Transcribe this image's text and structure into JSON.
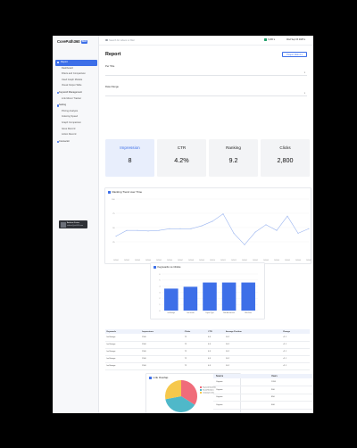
{
  "app": {
    "name": "CorePath360",
    "badge": "SEO"
  },
  "sidebar": {
    "items": [
      {
        "label": "Report",
        "active": true,
        "group": true
      },
      {
        "label": "Dashboard"
      },
      {
        "label": "Filters and Comparison"
      },
      {
        "label": "Used Graph Module"
      },
      {
        "label": "Visual Output Table"
      },
      {
        "label": "Keyword Management",
        "group": true
      },
      {
        "label": "Link Mover Tracker"
      },
      {
        "label": "Setting",
        "group": true
      },
      {
        "label": "Pricing Analysis"
      },
      {
        "label": "Indexing Speed"
      },
      {
        "label": "Graph Comparison"
      },
      {
        "label": "Issue Record"
      },
      {
        "label": "Action Record"
      },
      {
        "label": "Connector",
        "group": true
      }
    ],
    "user": {
      "name": "Andrew Foster",
      "email": "andrew@path360.com"
    }
  },
  "topbar": {
    "search_placeholder": "Search for videos or filter",
    "credits": "3,200 ▾",
    "date": "Wed Sep 03 2025 ▾"
  },
  "page": {
    "title": "Report",
    "project_button": "Project: Web A ▾"
  },
  "filters": [
    {
      "label": "Per Title",
      "caret": "▾"
    },
    {
      "label": "Date Range",
      "caret": "▾"
    }
  ],
  "metrics": [
    {
      "label": "Impression",
      "value": "8",
      "active": true
    },
    {
      "label": "CTR",
      "value": "4.2%"
    },
    {
      "label": "Ranking",
      "value": "9.2"
    },
    {
      "label": "Clicks",
      "value": "2,800"
    }
  ],
  "colors": {
    "accent": "#3d6fe8",
    "line": "#9cb6f0",
    "pie": [
      "#f06c7a",
      "#4fb8c9",
      "#f6c84c"
    ]
  },
  "chart_data": [
    {
      "type": "line",
      "title": "Ranking Trend over Time",
      "y_ticks": [
        "100",
        "75",
        "50",
        "25"
      ],
      "x": [
        "2023-01",
        "2023-02",
        "2023-03",
        "2023-04",
        "2023-05",
        "2023-06",
        "2023-07",
        "2023-08",
        "2023-09",
        "2023-10",
        "2023-11",
        "2023-12",
        "2024-01",
        "2024-02",
        "2024-03",
        "2024-04",
        "2024-05",
        "2024-06",
        "2024-07"
      ],
      "values": [
        35,
        45,
        45,
        44,
        45,
        48,
        48,
        48,
        53,
        61,
        74,
        40,
        20,
        42,
        55,
        45,
        70,
        40,
        48
      ],
      "ylim": [
        0,
        100
      ]
    },
    {
      "type": "bar",
      "title": "Keywords vs Clicks",
      "categories": [
        "kw.Storage",
        "Join Invoke",
        "Payout Type",
        "Web Architecture",
        "Web Store"
      ],
      "values": [
        3.6,
        3.9,
        4.6,
        4.6,
        4.6
      ],
      "y_ticks": [
        "0",
        "1",
        "2",
        "3",
        "4",
        "5",
        "6"
      ],
      "ylim": [
        0,
        6
      ]
    },
    {
      "type": "pie",
      "title": "Link Overlap",
      "legend": [
        "Keyword Backlinks",
        "Social Mentions",
        "Campaign Links"
      ],
      "values": [
        34,
        38,
        28
      ]
    }
  ],
  "keyword_table": {
    "headers": [
      "Keywords",
      "Impressions",
      "Clicks",
      "CTR",
      "Average Position",
      "Change"
    ],
    "rows": [
      [
        "kw.Storage",
        "1500",
        "72",
        "4.8",
        "10.2",
        "+2.1"
      ],
      [
        "kw.Storage",
        "1500",
        "72",
        "4.8",
        "10.2",
        "+2.1"
      ],
      [
        "kw.Storage",
        "1500",
        "72",
        "4.8",
        "10.2",
        "+2.1"
      ],
      [
        "kw.Storage",
        "1500",
        "72",
        "4.8",
        "10.2",
        "+2.1"
      ],
      [
        "kw.Storage",
        "1500",
        "72",
        "4.8",
        "10.2",
        "+2.1"
      ]
    ]
  },
  "source_table": {
    "headers": [
      "Source",
      "Users"
    ],
    "rows": [
      [
        "Organic",
        "1200"
      ],
      [
        "Organic",
        "900"
      ],
      [
        "Organic",
        "850"
      ],
      [
        "Organic",
        "600"
      ]
    ]
  }
}
